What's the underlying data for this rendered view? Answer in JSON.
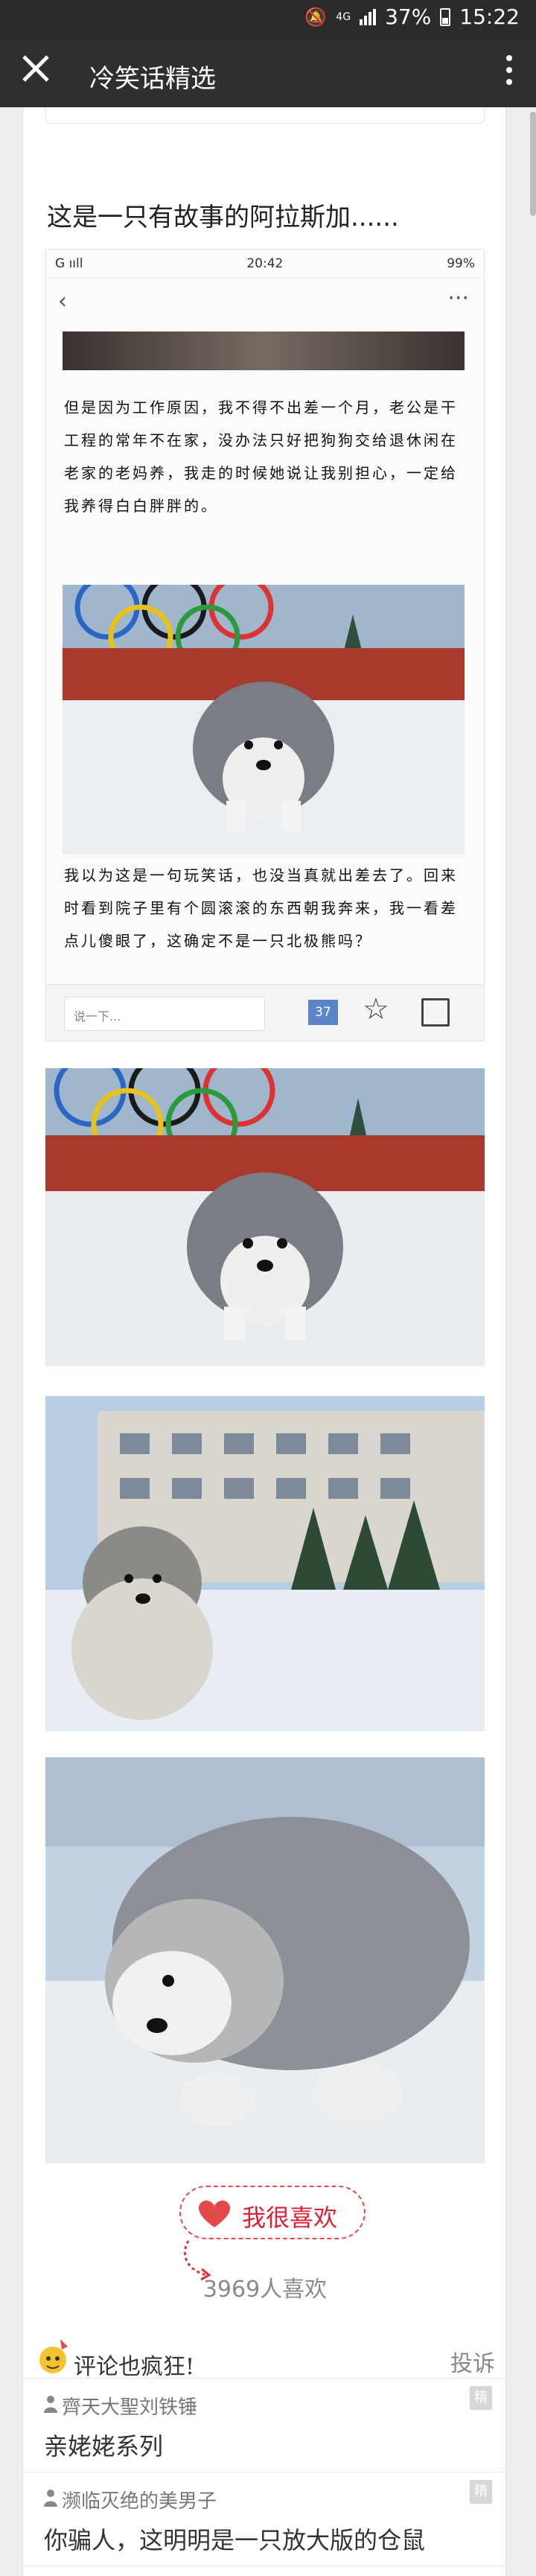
{
  "status_bar": {
    "time": "15:22",
    "battery": "37%",
    "network": "4G"
  },
  "app_bar": {
    "title": "冷笑话精选"
  },
  "post": {
    "title": "这是一只有故事的阿拉斯加......"
  },
  "embedded_phone": {
    "status_left": "G ııll",
    "status_time": "20:42",
    "status_right": "99%",
    "paragraph1": "但是因为工作原因，我不得不出差一个月，老公是干工程的常年不在家，没办法只好把狗狗交给退休闲在老家的老妈养，我走的时候她说让我别担心，一定给我养得白白胖胖的。",
    "paragraph2": "我以为这是一句玩笑话，也没当真就出差去了。回来时看到院子里有个圆滚滚的东西朝我奔来，我一看差点儿傻眼了，这确定不是一只北极熊吗？",
    "comment_placeholder": "说一下...",
    "comment_count": "37"
  },
  "like": {
    "label": "我很喜欢",
    "count_text": "3969人喜欢"
  },
  "comments": {
    "heading": "评论也疯狂!",
    "report": "投诉",
    "badge": "精",
    "items": [
      {
        "user": "齊天大聖刘铁锤",
        "text": "亲姥姥系列"
      },
      {
        "user": "濒临灭绝的美男子",
        "text": "你骗人，这明明是一只放大版的仓鼠"
      }
    ]
  },
  "colors": {
    "app_bar": "#2e2f30",
    "like_red": "#e54a4a",
    "badge_blue": "#5a86c9"
  }
}
